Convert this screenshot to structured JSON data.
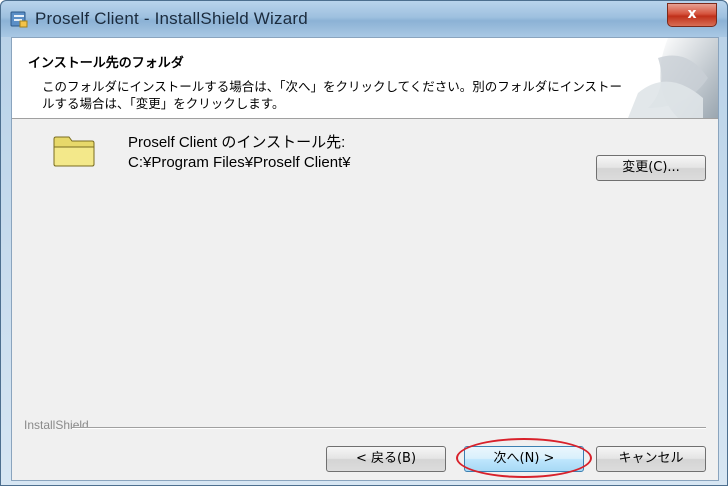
{
  "window": {
    "title": "Proself Client - InstallShield Wizard",
    "close_label": "x"
  },
  "header": {
    "title": "インストール先のフォルダ",
    "description": "このフォルダにインストールする場合は、「次へ」をクリックしてください。別のフォルダにインストールする場合は、「変更」をクリックします。"
  },
  "destination": {
    "label": "Proself Client のインストール先:",
    "path": "C:¥Program Files¥Proself Client¥",
    "change_button": "変更(C)..."
  },
  "footer": {
    "brand": "InstallShield",
    "back_button": "< 戻る(B)",
    "next_button": "次へ(N) >",
    "cancel_button": "キャンセル"
  },
  "colors": {
    "highlight": "#d8212b",
    "folder": "#f3e88a"
  }
}
